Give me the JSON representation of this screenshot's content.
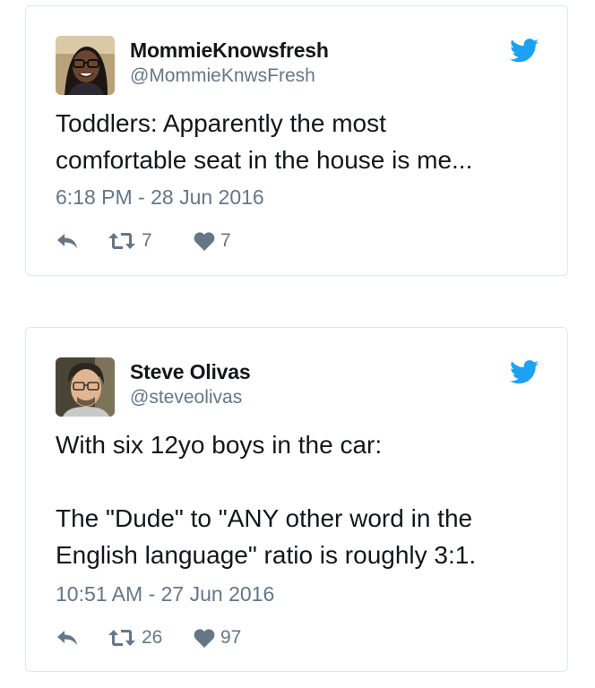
{
  "colors": {
    "text": "#14171a",
    "muted": "#657786",
    "border": "#e1e8ed",
    "twitter_blue": "#1da1f2"
  },
  "tweets": [
    {
      "display_name": "MommieKnowsfresh",
      "handle": "@MommieKnwsFresh",
      "text": "Toddlers: Apparently the most\ncomfortable seat in the house is me...",
      "timestamp": "6:18 PM - 28 Jun 2016",
      "retweets": "7",
      "likes": "7",
      "icons": [
        "avatar",
        "twitter-bird-icon",
        "reply-icon",
        "retweet-icon",
        "heart-icon"
      ]
    },
    {
      "display_name": "Steve Olivas",
      "handle": "@steveolivas",
      "text": "With six 12yo boys in the car:\n\nThe \"Dude\" to \"ANY other word in the\nEnglish language\" ratio is roughly 3:1.",
      "timestamp": "10:51 AM - 27 Jun 2016",
      "retweets": "26",
      "likes": "97",
      "icons": [
        "avatar",
        "twitter-bird-icon",
        "reply-icon",
        "retweet-icon",
        "heart-icon"
      ]
    }
  ]
}
